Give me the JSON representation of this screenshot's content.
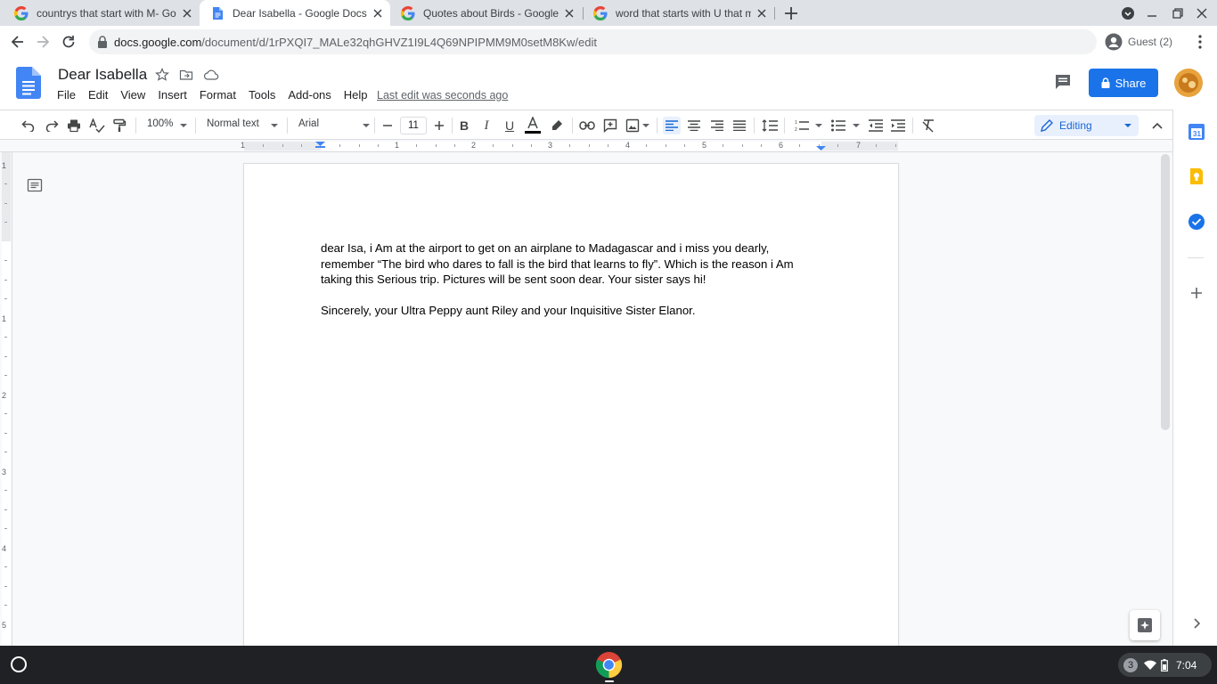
{
  "browser": {
    "tabs": [
      {
        "title": "countrys that start with M- Goo",
        "icon": "google-icon",
        "active": false
      },
      {
        "title": "Dear Isabella - Google Docs",
        "icon": "docs-icon",
        "active": true
      },
      {
        "title": "Quotes about Birds - Google Sea",
        "icon": "google-icon",
        "active": false
      },
      {
        "title": "word that starts with U that mea",
        "icon": "google-icon",
        "active": false
      }
    ],
    "url_host": "docs.google.com",
    "url_path": "/document/d/1rPXQI7_MALe32qhGHVZ1I9L4Q69NPIPMM9M0setM8Kw/edit",
    "profile_label": "Guest (2)"
  },
  "docs": {
    "title": "Dear Isabella",
    "menu": [
      "File",
      "Edit",
      "View",
      "Insert",
      "Format",
      "Tools",
      "Add-ons",
      "Help"
    ],
    "last_edit": "Last edit was seconds ago",
    "share_label": "Share",
    "toolbar": {
      "zoom": "100%",
      "style": "Normal text",
      "font": "Arial",
      "font_size": "11",
      "mode": "Editing"
    },
    "ruler_numbers": [
      "1",
      "1",
      "2",
      "3",
      "4",
      "5",
      "6",
      "7"
    ],
    "vruler_numbers": [
      "1",
      "1",
      "2",
      "3",
      "4",
      "5"
    ],
    "body": [
      "dear Isa, i Am at the airport to get on an airplane to Madagascar and i miss you dearly, remember “The bird who dares to fall is the bird that learns to fly”. Which is the reason i Am taking this Serious trip. Pictures will be sent soon dear. Your sister says hi!",
      "Sincerely, your Ultra Peppy aunt Riley and your Inquisitive Sister Elanor."
    ]
  },
  "shelf": {
    "notification_count": "3",
    "time": "7:04"
  },
  "colors": {
    "accent": "#1a73e8",
    "calendar": "#4285f4",
    "keep": "#fbbc04",
    "tasks": "#1a73e8"
  }
}
